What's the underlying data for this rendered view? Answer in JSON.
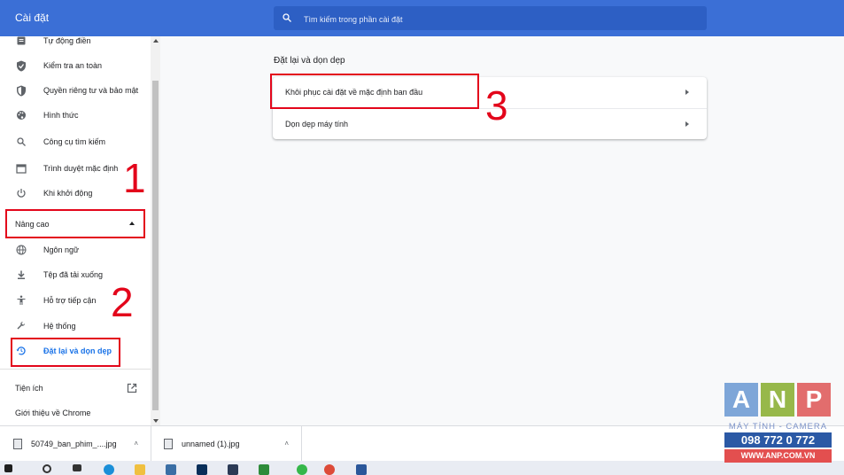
{
  "header": {
    "title": "Cài đặt",
    "search_placeholder": "Tìm kiếm trong phần cài đặt"
  },
  "sidebar": {
    "items": [
      {
        "label": "Tự động điền",
        "icon": "autofill-icon"
      },
      {
        "label": "Kiểm tra an toàn",
        "icon": "shield-check-icon"
      },
      {
        "label": "Quyền riêng tư và bảo mật",
        "icon": "shield-icon"
      },
      {
        "label": "Hình thức",
        "icon": "palette-icon"
      },
      {
        "label": "Công cụ tìm kiếm",
        "icon": "search-icon"
      },
      {
        "label": "Trình duyệt mặc định",
        "icon": "browser-icon"
      },
      {
        "label": "Khi khởi động",
        "icon": "power-icon"
      }
    ],
    "advanced_label": "Nâng cao",
    "advanced_items": [
      {
        "label": "Ngôn ngữ",
        "icon": "globe-icon"
      },
      {
        "label": "Tệp đã tải xuống",
        "icon": "download-icon"
      },
      {
        "label": "Hỗ trợ tiếp cận",
        "icon": "accessibility-icon"
      },
      {
        "label": "Hệ thống",
        "icon": "wrench-icon"
      },
      {
        "label": "Đặt lại và dọn dẹp",
        "icon": "restore-icon"
      }
    ],
    "extensions_label": "Tiện ích",
    "about_label": "Giới thiệu về Chrome"
  },
  "main": {
    "heading": "Đặt lại và dọn dẹp",
    "rows": [
      {
        "label": "Khôi phục cài đặt về mặc định ban đầu"
      },
      {
        "label": "Dọn dẹp máy tính"
      }
    ]
  },
  "annotations": {
    "n1": "1",
    "n2": "2",
    "n3": "3",
    "color": "#e3061b"
  },
  "downloads": [
    {
      "name": "50749_ban_phim_....jpg"
    },
    {
      "name": "unnamed (1).jpg"
    }
  ],
  "watermark": {
    "letters": [
      "A",
      "N",
      "P"
    ],
    "tagline": "MÁY TÍNH - CAMERA",
    "phone": "098 772 0 772",
    "website": "WWW.ANP.COM.VN"
  },
  "colors": {
    "header": "#3b6fd6",
    "accent": "#1a73e8",
    "highlight": "#e3061b"
  }
}
